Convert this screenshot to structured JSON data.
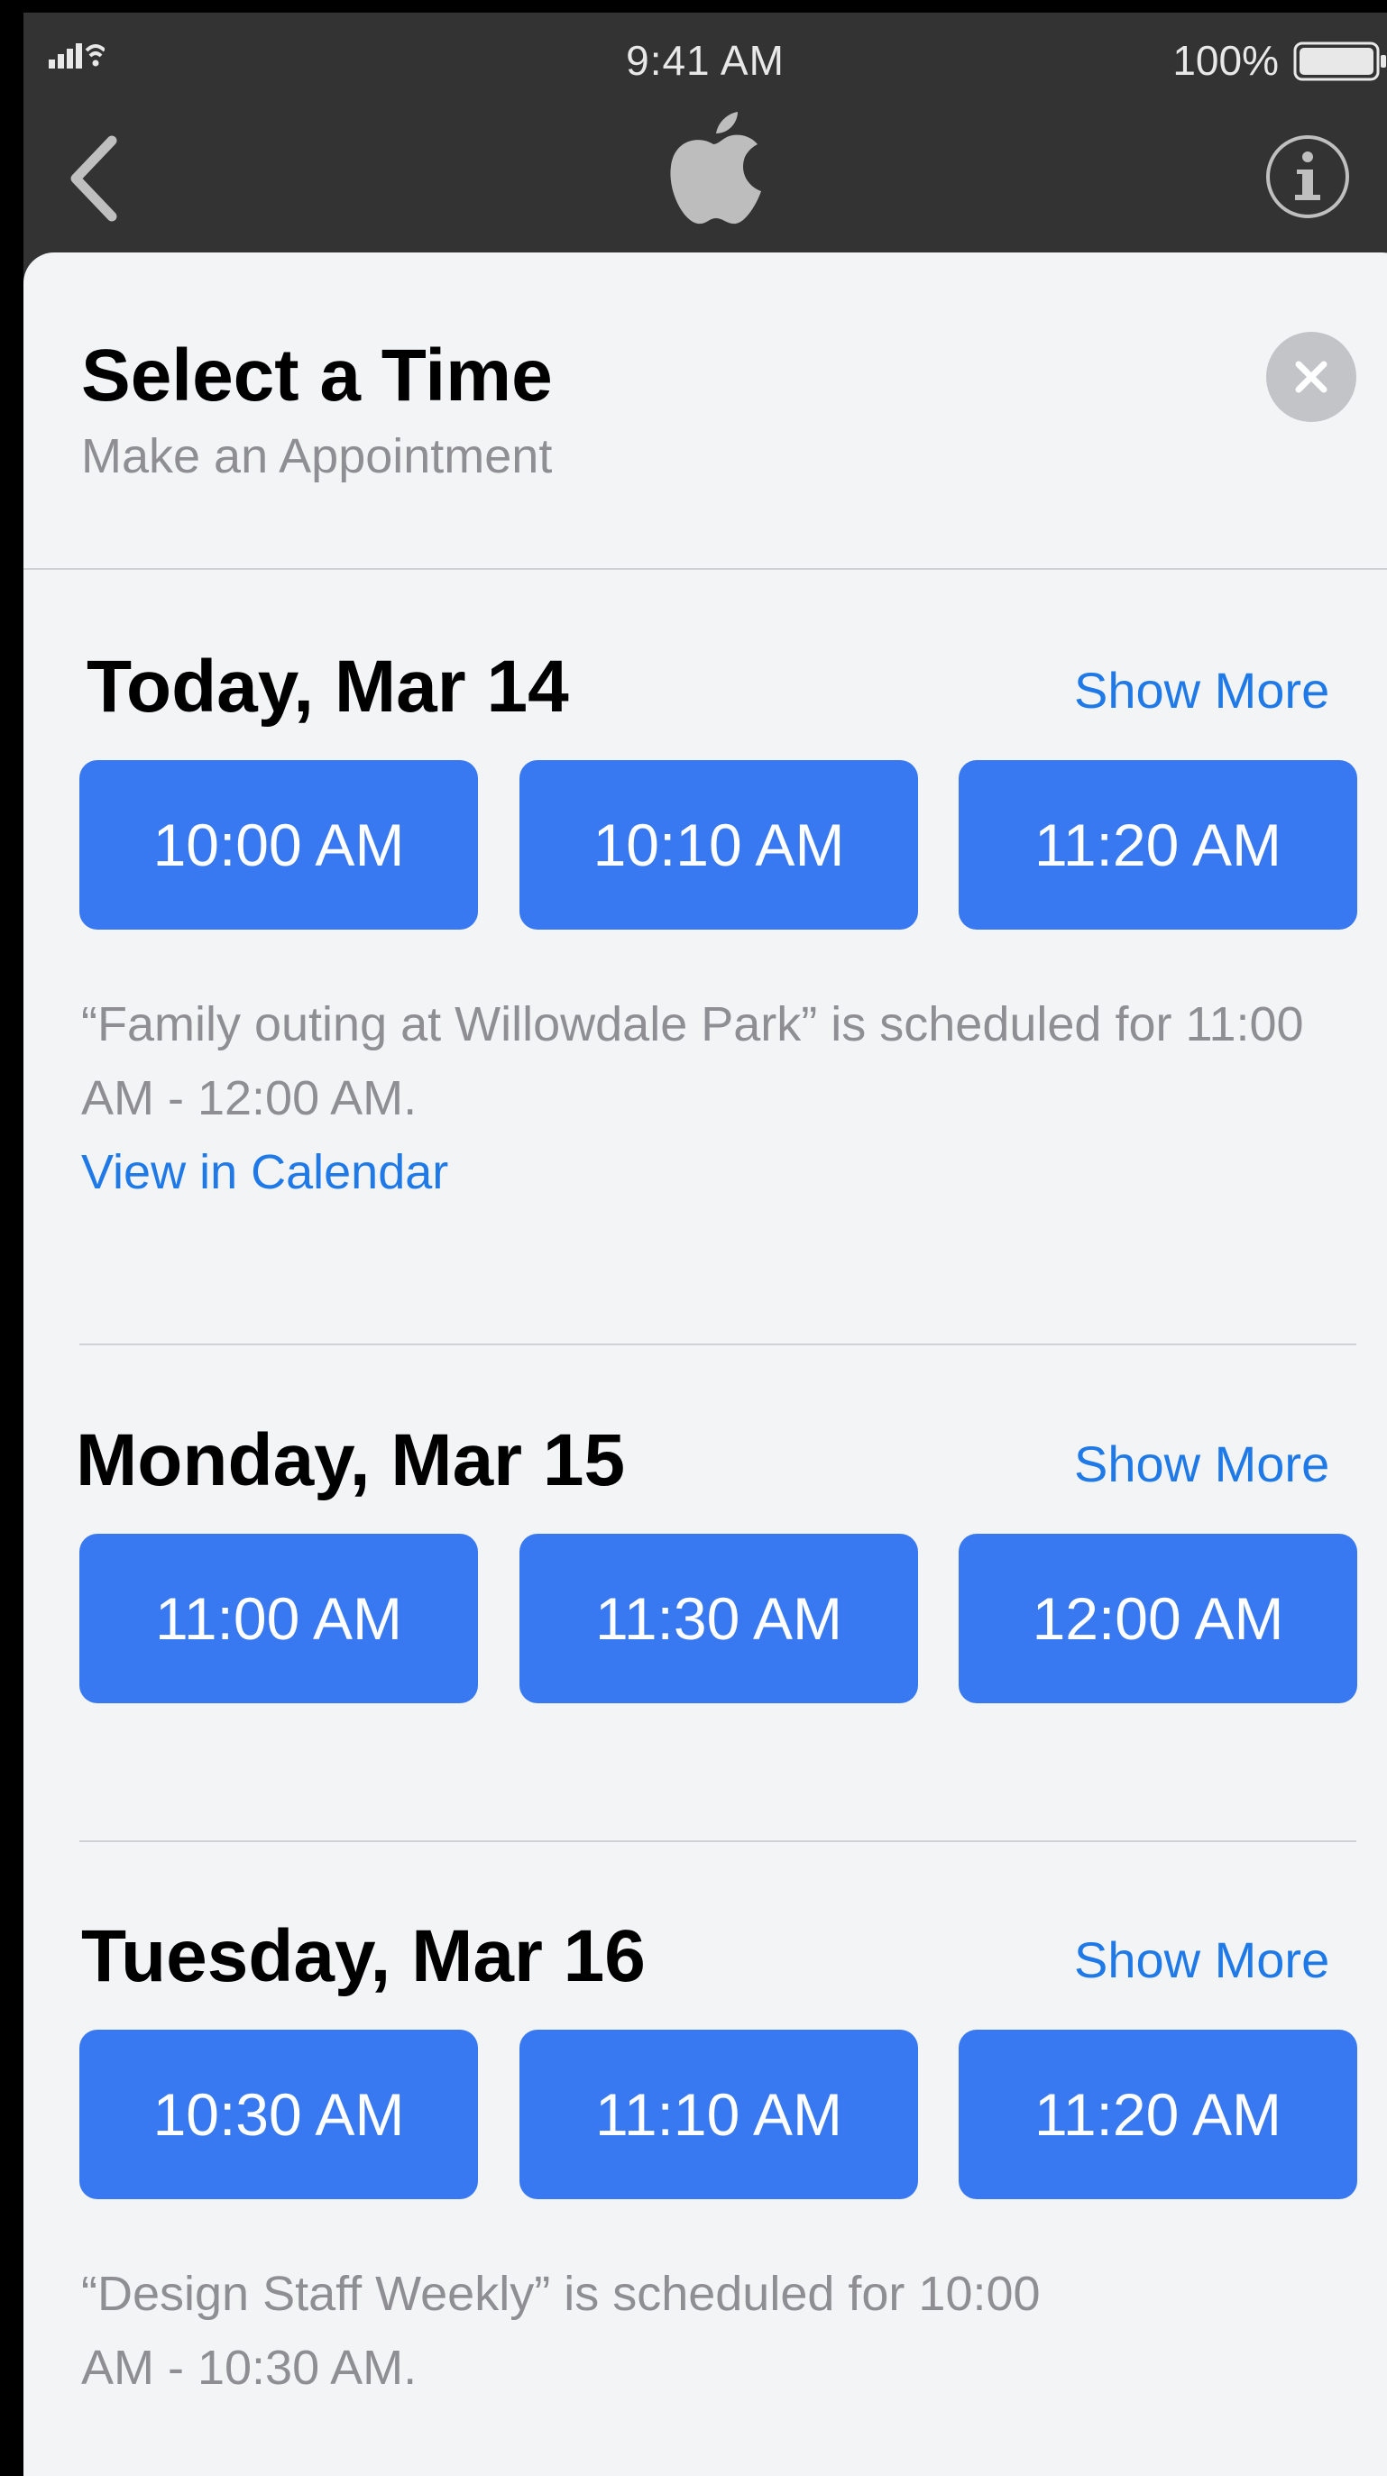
{
  "status_bar": {
    "time": "9:41 AM",
    "battery_percent": "100%"
  },
  "nav": {
    "back_icon": "chevron-left-icon",
    "logo_icon": "apple-logo-icon",
    "info_icon": "info-icon"
  },
  "sheet": {
    "title": "Select a Time",
    "subtitle": "Make an Appointment",
    "close_icon": "close-icon"
  },
  "days": [
    {
      "title": "Today, Mar 14",
      "show_more": "Show More",
      "slots": [
        "10:00 AM",
        "10:10 AM",
        "11:20 AM"
      ],
      "conflict_text": "“Family outing at Willowdale Park” is scheduled for 11:00 AM - 12:00 AM.",
      "conflict_link": "View in Calendar"
    },
    {
      "title": "Monday, Mar 15",
      "show_more": "Show More",
      "slots": [
        "11:00 AM",
        "11:30 AM",
        "12:00 AM"
      ]
    },
    {
      "title": "Tuesday, Mar 16",
      "show_more": "Show More",
      "slots": [
        "10:30 AM",
        "11:10 AM",
        "11:20 AM"
      ],
      "conflict_text": "“Design Staff Weekly” is scheduled for 10:00 AM - 10:30 AM."
    }
  ],
  "colors": {
    "accent": "#3879f2",
    "link": "#1f7ae8",
    "sheet_bg": "#f2f4f6",
    "nav_bg": "#333333"
  }
}
